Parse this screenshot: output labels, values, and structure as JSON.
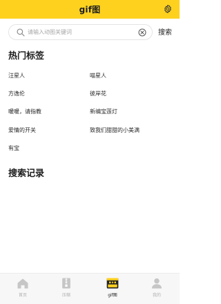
{
  "header": {
    "title": "gif图"
  },
  "search": {
    "placeholder": "请输入动图关键词",
    "button_label": "搜索"
  },
  "hot_tags": {
    "title": "热门标签",
    "tags": [
      "汪星人",
      "喵星人",
      "方逸伦",
      "彼岸花",
      "暖暖，请指教",
      "新编宝莲灯",
      "爱情的开关",
      "致我们甜甜的小美满",
      "有宝"
    ]
  },
  "history": {
    "title": "搜索记录"
  },
  "tabbar": {
    "tabs": [
      {
        "label": "首页",
        "icon": "home-icon"
      },
      {
        "label": "压缩",
        "icon": "compress-icon"
      },
      {
        "label": "gif图",
        "icon": "gif-icon"
      },
      {
        "label": "我的",
        "icon": "user-icon"
      }
    ],
    "active_index": 2
  },
  "colors": {
    "accent": "#fed11f"
  }
}
